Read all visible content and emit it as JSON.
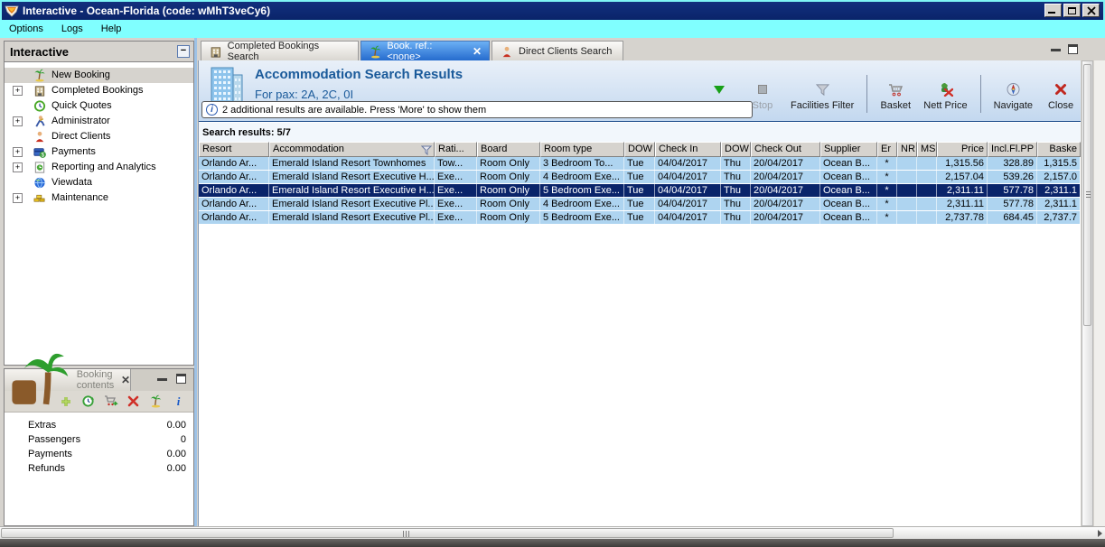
{
  "colors": {
    "titlebar": "#0a246a",
    "menubar": "#80ffff",
    "row_blue": "#aed4f0",
    "row_selected": "#0a246a",
    "active_tab": "#2268cc",
    "panel_gray": "#d6d3ce",
    "header_band_top": "#e9f0f9",
    "header_band_bottom": "#c3d8ef",
    "title_text": "#1a5a9a"
  },
  "window": {
    "title": "Interactive - Ocean-Florida (code: wMhT3veCy6)",
    "menu": [
      {
        "label": "Options"
      },
      {
        "label": "Logs"
      },
      {
        "label": "Help"
      }
    ]
  },
  "sidebar": {
    "title": "Interactive",
    "items": [
      {
        "label": "New Booking",
        "icon": "palm-tree-icon",
        "expandable": false,
        "selected": true
      },
      {
        "label": "Completed Bookings",
        "icon": "building-icon",
        "expandable": true,
        "selected": false
      },
      {
        "label": "Quick Quotes",
        "icon": "clock-icon",
        "expandable": false,
        "selected": false
      },
      {
        "label": "Administrator",
        "icon": "admin-person-icon",
        "expandable": true,
        "selected": false
      },
      {
        "label": "Direct Clients",
        "icon": "client-person-icon",
        "expandable": false,
        "selected": false
      },
      {
        "label": "Payments",
        "icon": "payments-icon",
        "expandable": true,
        "selected": false
      },
      {
        "label": "Reporting and Analytics",
        "icon": "report-chart-icon",
        "expandable": true,
        "selected": false
      },
      {
        "label": "Viewdata",
        "icon": "globe-icon",
        "expandable": false,
        "selected": false
      },
      {
        "label": "Maintenance",
        "icon": "maintenance-bricks-icon",
        "expandable": true,
        "selected": false
      }
    ]
  },
  "tabs": [
    {
      "label": "Completed Bookings Search",
      "icon": "building-icon",
      "active": false,
      "closable": false
    },
    {
      "label": "Book. ref.: <none>",
      "icon": "palm-tree-icon",
      "active": true,
      "closable": true
    },
    {
      "label": "Direct Clients Search",
      "icon": "client-person-icon",
      "active": false,
      "closable": false
    }
  ],
  "main": {
    "title": "Accommodation Search Results",
    "subtitle": "For pax: 2A, 2C, 0I",
    "info_message": "2 additional results are available. Press 'More' to show them",
    "results_label": "Search results: 5/7",
    "toolbar": [
      {
        "label": "More",
        "icon": "more-triangle-icon",
        "enabled": true
      },
      {
        "label": "Stop",
        "icon": "stop-square-icon",
        "enabled": false
      },
      {
        "label": "Facilities Filter",
        "icon": "filter-funnel-icon",
        "enabled": true
      },
      {
        "label": "Basket",
        "icon": "basket-cart-icon",
        "enabled": true
      },
      {
        "label": "Nett Price",
        "icon": "nett-price-icon",
        "enabled": true
      },
      {
        "label": "Navigate",
        "icon": "navigate-compass-icon",
        "enabled": true
      },
      {
        "label": "Close",
        "icon": "close-x-icon",
        "enabled": true
      }
    ],
    "table": {
      "columns": [
        "Resort",
        "Accommodation",
        "Rati...",
        "Board",
        "Room type",
        "DOW",
        "Check In",
        "DOW",
        "Check Out",
        "Supplier",
        "Er",
        "NR",
        "MS",
        "Price",
        "Incl.Fl.PP",
        "Baske"
      ],
      "selected_row_index": 2,
      "rows": [
        [
          "Orlando Ar...",
          "Emerald Island Resort Townhomes",
          "Tow...",
          "Room Only",
          "3 Bedroom To...",
          "Tue",
          "04/04/2017",
          "Thu",
          "20/04/2017",
          "Ocean B...",
          "*",
          "",
          "",
          "1,315.56",
          "328.89",
          "1,315.5"
        ],
        [
          "Orlando Ar...",
          "Emerald Island Resort Executive H...",
          "Exe...",
          "Room Only",
          "4 Bedroom Exe...",
          "Tue",
          "04/04/2017",
          "Thu",
          "20/04/2017",
          "Ocean B...",
          "*",
          "",
          "",
          "2,157.04",
          "539.26",
          "2,157.0"
        ],
        [
          "Orlando Ar...",
          "Emerald Island Resort Executive H...",
          "Exe...",
          "Room Only",
          "5 Bedroom Exe...",
          "Tue",
          "04/04/2017",
          "Thu",
          "20/04/2017",
          "Ocean B...",
          "*",
          "",
          "",
          "2,311.11",
          "577.78",
          "2,311.1"
        ],
        [
          "Orlando Ar...",
          "Emerald Island Resort Executive Pl...",
          "Exe...",
          "Room Only",
          "4 Bedroom Exe...",
          "Tue",
          "04/04/2017",
          "Thu",
          "20/04/2017",
          "Ocean B...",
          "*",
          "",
          "",
          "2,311.11",
          "577.78",
          "2,311.1"
        ],
        [
          "Orlando Ar...",
          "Emerald Island Resort Executive Pl...",
          "Exe...",
          "Room Only",
          "5 Bedroom Exe...",
          "Tue",
          "04/04/2017",
          "Thu",
          "20/04/2017",
          "Ocean B...",
          "*",
          "",
          "",
          "2,737.78",
          "684.45",
          "2,737.7"
        ]
      ]
    }
  },
  "booking_contents": {
    "title": "Booking contents",
    "toolbar_icons": [
      "add-icon",
      "refresh-clock-icon",
      "cart-arrow-icon",
      "delete-x-icon",
      "palm-tree-icon",
      "info-i-icon"
    ],
    "rows": [
      {
        "label": "Extras",
        "value": "0.00"
      },
      {
        "label": "Passengers",
        "value": "0"
      },
      {
        "label": "Payments",
        "value": "0.00"
      },
      {
        "label": "Refunds",
        "value": "0.00"
      }
    ]
  }
}
